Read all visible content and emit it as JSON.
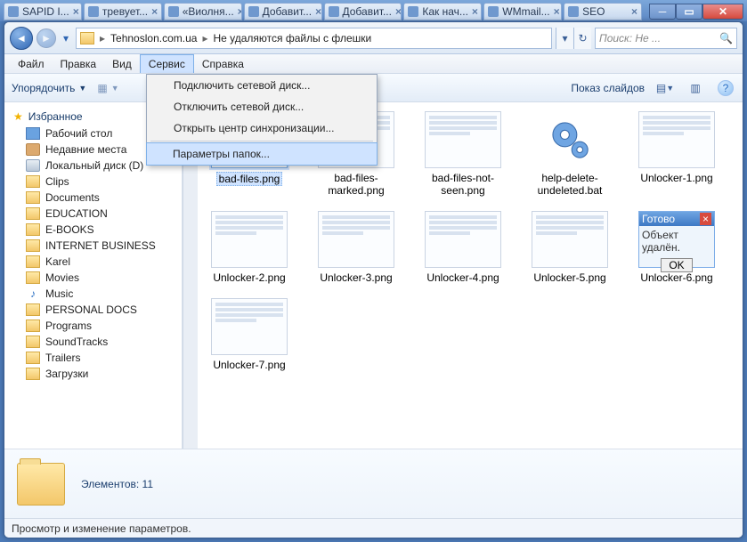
{
  "tabs": [
    {
      "label": "SAPID I..."
    },
    {
      "label": "тревует..."
    },
    {
      "label": "«Виолня..."
    },
    {
      "label": "Добавит..."
    },
    {
      "label": "Добавит..."
    },
    {
      "label": "Как нач..."
    },
    {
      "label": "WMmail..."
    },
    {
      "label": "SEO"
    }
  ],
  "breadcrumb": {
    "seg1": "Tehnoslon.com.ua",
    "seg2": "Не удаляются файлы с флешки"
  },
  "search": {
    "placeholder": "Поиск: Не ..."
  },
  "menubar": {
    "file": "Файл",
    "edit": "Правка",
    "view": "Вид",
    "tools": "Сервис",
    "help": "Справка"
  },
  "tools_menu": {
    "map_drive": "Подключить сетевой диск...",
    "unmap_drive": "Отключить сетевой диск...",
    "sync_center": "Открыть центр синхронизации...",
    "folder_options": "Параметры папок..."
  },
  "toolbar": {
    "organize": "Упорядочить",
    "slideshow": "Показ слайдов"
  },
  "sidebar": {
    "favorites": "Избранное",
    "items": [
      {
        "label": "Рабочий стол",
        "icon": "desk"
      },
      {
        "label": "Недавние места",
        "icon": "recent"
      },
      {
        "label": "Локальный диск (D)",
        "icon": "disk"
      },
      {
        "label": "Clips",
        "icon": "folder"
      },
      {
        "label": "Documents",
        "icon": "folder"
      },
      {
        "label": "EDUCATION",
        "icon": "folder"
      },
      {
        "label": "E-BOOKS",
        "icon": "folder"
      },
      {
        "label": "INTERNET BUSINESS",
        "icon": "folder"
      },
      {
        "label": "Karel",
        "icon": "folder"
      },
      {
        "label": "Movies",
        "icon": "folder"
      },
      {
        "label": "Music",
        "icon": "music"
      },
      {
        "label": "PERSONAL DOCS",
        "icon": "folder"
      },
      {
        "label": "Programs",
        "icon": "folder"
      },
      {
        "label": "SoundTracks",
        "icon": "folder"
      },
      {
        "label": "Trailers",
        "icon": "folder"
      },
      {
        "label": "Загрузки",
        "icon": "folder"
      }
    ]
  },
  "files": [
    {
      "name": "bad-files.png",
      "kind": "doc",
      "selected": true
    },
    {
      "name": "bad-files-marked.png",
      "kind": "doc"
    },
    {
      "name": "bad-files-not-seen.png",
      "kind": "doc"
    },
    {
      "name": "help-delete-undeleted.bat",
      "kind": "gear"
    },
    {
      "name": "Unlocker-1.png",
      "kind": "doc"
    },
    {
      "name": "Unlocker-2.png",
      "kind": "doc"
    },
    {
      "name": "Unlocker-3.png",
      "kind": "doc"
    },
    {
      "name": "Unlocker-4.png",
      "kind": "doc"
    },
    {
      "name": "Unlocker-5.png",
      "kind": "doc"
    },
    {
      "name": "Unlocker-6.png",
      "kind": "dialog"
    },
    {
      "name": "Unlocker-7.png",
      "kind": "doc"
    }
  ],
  "dialog_thumb": {
    "title": "Готово",
    "body": "Объект удалён.",
    "ok": "OK"
  },
  "details": {
    "label": "Элементов:",
    "count": "11"
  },
  "status": {
    "text": "Просмотр и изменение параметров."
  }
}
